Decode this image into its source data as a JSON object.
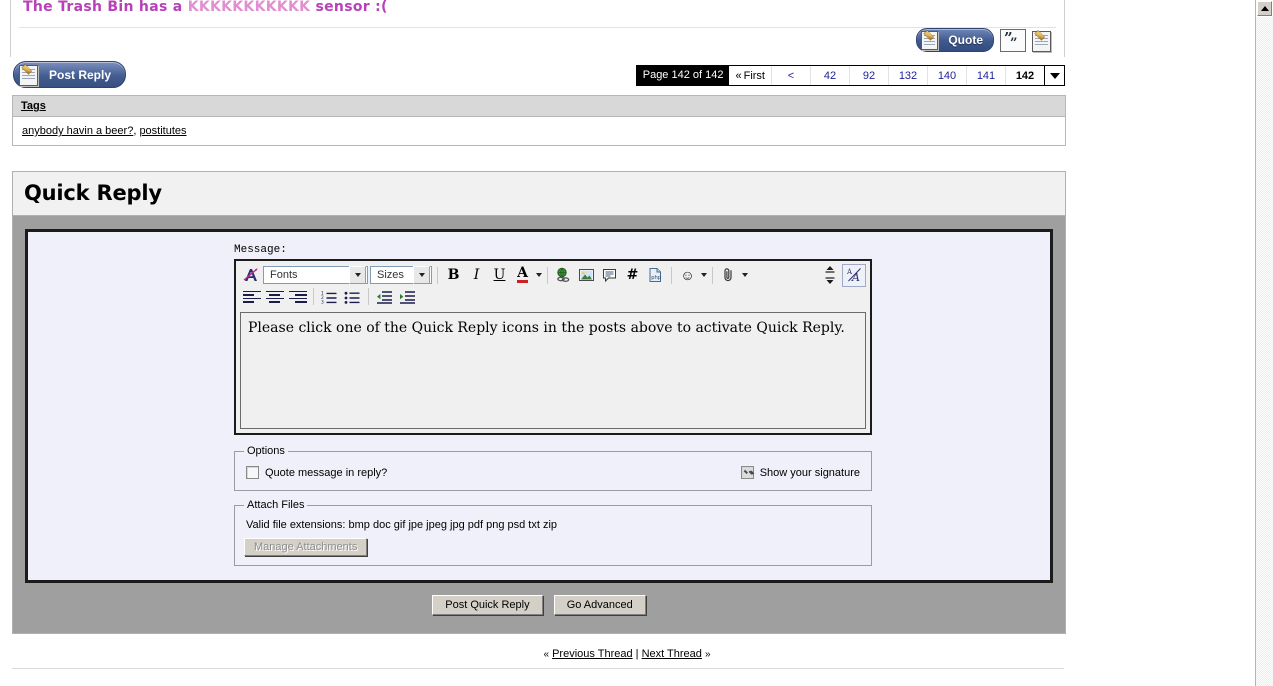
{
  "signature": {
    "segments": [
      {
        "text": "The Trash Bin has a ",
        "color": "#b840b8"
      },
      {
        "text": "KKKKKKKKKKK",
        "color": "#e08fd0"
      },
      {
        "text": " sensor :(",
        "color": "#b840b8"
      }
    ],
    "full_text": "The Trash Bin has a KKKKKKKKKKK sensor :("
  },
  "post_actions": {
    "quote_label": "Quote",
    "quote_icon": "quote-paper-pencil-icon",
    "multiquote_icon": "multiquote-icon",
    "quickreply_icon": "quick-reply-paper-pencil-icon"
  },
  "toolbar": {
    "post_reply_label": "Post Reply",
    "post_reply_icon": "post-reply-paper-pencil-icon"
  },
  "pagenav": {
    "current_label": "Page 142 of 142",
    "first_label": "First",
    "first_chevron": "«",
    "prev_label": "<",
    "pages": [
      "42",
      "92",
      "132",
      "140",
      "141"
    ],
    "selected_page": "142",
    "dropdown_icon": "chevron-down-icon"
  },
  "tags": {
    "heading": "Tags",
    "items": [
      "anybody havin a beer?",
      "postitutes"
    ],
    "separator": ", "
  },
  "quick_reply": {
    "title": "Quick Reply",
    "message_label": "Message:",
    "message_value": "Please click one of the Quick Reply icons in the posts above to activate Quick Reply.",
    "editor": {
      "remove_format_icon": "remove-formatting-icon",
      "fonts_label": "Fonts",
      "sizes_label": "Sizes",
      "bold_label": "B",
      "italic_label": "I",
      "underline_label": "U",
      "font_color_label": "A",
      "font_color_swatch": "#cf2020",
      "icons_row1": [
        "insert-link-icon",
        "insert-image-icon",
        "insert-quote-icon",
        "insert-code-icon",
        "insert-php-icon",
        "smilie-icon",
        "attachment-paperclip-icon",
        "resize-editor-icon",
        "toggle-wysiwyg-icon"
      ],
      "code_label": "#",
      "php_label": "php",
      "smilie_glyph": "☺",
      "paperclip_glyph": "⌇",
      "icons_row2": [
        "align-left-icon",
        "align-center-icon",
        "align-right-icon",
        "ordered-list-icon",
        "unordered-list-icon",
        "outdent-icon",
        "indent-icon"
      ]
    },
    "options": {
      "legend": "Options",
      "quote_in_reply_label": "Quote message in reply?",
      "quote_in_reply_checked": false,
      "show_signature_label": "Show your signature",
      "show_signature_checked": true
    },
    "attach": {
      "legend": "Attach Files",
      "extensions_text": "Valid file extensions: bmp doc gif jpe jpeg jpg pdf png psd txt zip",
      "manage_button_label": "Manage Attachments",
      "manage_button_disabled": true
    },
    "actions": {
      "post_label": "Post Quick Reply",
      "advanced_label": "Go Advanced"
    }
  },
  "thread_nav": {
    "prev_chevron": "«",
    "prev_label": "Previous Thread",
    "divider": "|",
    "next_label": "Next Thread",
    "next_chevron": "»"
  },
  "scrollbar": {
    "up_arrow_icon": "scroll-up-arrow-icon"
  }
}
